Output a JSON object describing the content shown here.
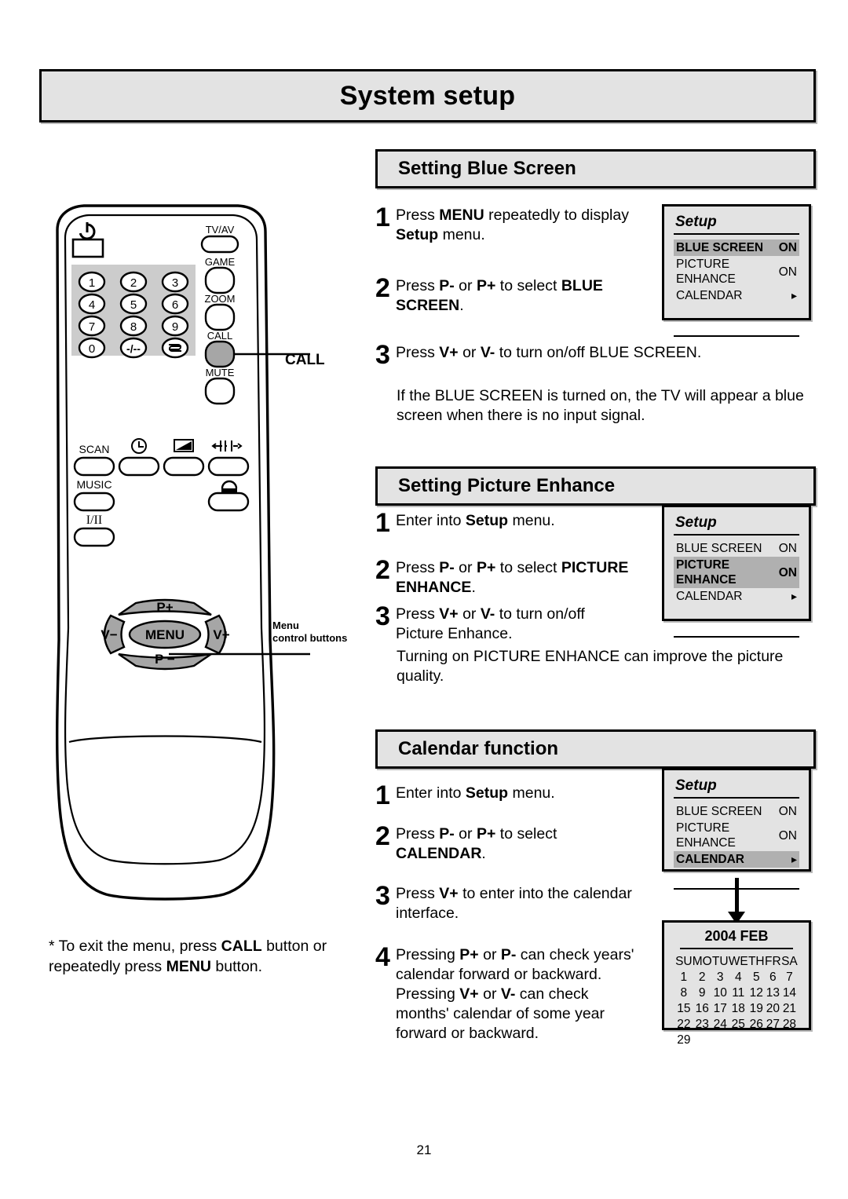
{
  "page": {
    "title": "System setup",
    "number": "21"
  },
  "remote": {
    "power_icon": "power-icon",
    "keypad": [
      "1",
      "2",
      "3",
      "4",
      "5",
      "6",
      "7",
      "8",
      "9",
      "0",
      "-/--",
      "swap-icon"
    ],
    "side_buttons": [
      "TV/AV",
      "GAME",
      "ZOOM",
      "CALL",
      "MUTE"
    ],
    "function_buttons": [
      "SCAN",
      "clock-icon",
      "contrast-icon",
      "p-position-icon",
      "MUSIC",
      "lock-icon",
      "I/II"
    ],
    "menu_cluster": {
      "up": "P+",
      "down": "P −",
      "left": "V−",
      "right": "V+",
      "center": "MENU"
    },
    "callouts": {
      "call": "CALL",
      "menu_controls_line1": "Menu",
      "menu_controls_line2": "control buttons"
    }
  },
  "sections": [
    {
      "heading": "Setting Blue Screen",
      "steps": [
        {
          "num": "1",
          "parts": [
            {
              "t": "Press ",
              "b": false
            },
            {
              "t": "MENU",
              "b": true
            },
            {
              "t": " repeatedly to display ",
              "b": false
            },
            {
              "t": "Setup",
              "b": true
            },
            {
              "t": " menu.",
              "b": false
            }
          ]
        },
        {
          "num": "2",
          "parts": [
            {
              "t": "Press ",
              "b": false
            },
            {
              "t": "P-",
              "b": true
            },
            {
              "t": " or ",
              "b": false
            },
            {
              "t": "P+",
              "b": true
            },
            {
              "t": " to select ",
              "b": false
            },
            {
              "t": "BLUE SCREEN",
              "b": true
            },
            {
              "t": ".",
              "b": false
            }
          ]
        },
        {
          "num": "3",
          "parts": [
            {
              "t": "Press ",
              "b": false
            },
            {
              "t": "V+",
              "b": true
            },
            {
              "t": " or ",
              "b": false
            },
            {
              "t": "V-",
              "b": true
            },
            {
              "t": " to turn on/off BLUE SCREEN.",
              "b": false
            }
          ]
        }
      ],
      "note": "If the BLUE SCREEN is turned on, the TV will appear a blue screen when there is no input signal.",
      "osd": {
        "title": "Setup",
        "rows": [
          {
            "label": "BLUE SCREEN",
            "value": "ON",
            "selected": true
          },
          {
            "label": "PICTURE ENHANCE",
            "value": "ON",
            "selected": false
          },
          {
            "label": "CALENDAR",
            "value": "▸",
            "selected": false
          }
        ]
      }
    },
    {
      "heading": "Setting Picture Enhance",
      "steps": [
        {
          "num": "1",
          "parts": [
            {
              "t": "Enter into ",
              "b": false
            },
            {
              "t": "Setup",
              "b": true
            },
            {
              "t": " menu.",
              "b": false
            }
          ]
        },
        {
          "num": "2",
          "parts": [
            {
              "t": "Press ",
              "b": false
            },
            {
              "t": "P-",
              "b": true
            },
            {
              "t": " or ",
              "b": false
            },
            {
              "t": "P+",
              "b": true
            },
            {
              "t": " to select ",
              "b": false
            },
            {
              "t": "PICTURE ENHANCE",
              "b": true
            },
            {
              "t": ".",
              "b": false
            }
          ]
        },
        {
          "num": "3",
          "parts": [
            {
              "t": "Press ",
              "b": false
            },
            {
              "t": "V+",
              "b": true
            },
            {
              "t": " or ",
              "b": false
            },
            {
              "t": "V-",
              "b": true
            },
            {
              "t": " to turn on/off Picture Enhance.",
              "b": false
            }
          ]
        }
      ],
      "note": "Turning on PICTURE ENHANCE can improve the picture quality.",
      "osd": {
        "title": "Setup",
        "rows": [
          {
            "label": "BLUE SCREEN",
            "value": "ON",
            "selected": false
          },
          {
            "label": "PICTURE ENHANCE",
            "value": "ON",
            "selected": true
          },
          {
            "label": "CALENDAR",
            "value": "▸",
            "selected": false
          }
        ]
      }
    },
    {
      "heading": "Calendar function",
      "steps": [
        {
          "num": "1",
          "parts": [
            {
              "t": "Enter into ",
              "b": false
            },
            {
              "t": "Setup",
              "b": true
            },
            {
              "t": " menu.",
              "b": false
            }
          ]
        },
        {
          "num": "2",
          "parts": [
            {
              "t": "Press ",
              "b": false
            },
            {
              "t": "P-",
              "b": true
            },
            {
              "t": " or ",
              "b": false
            },
            {
              "t": "P+",
              "b": true
            },
            {
              "t": " to select ",
              "b": false
            },
            {
              "t": "CALENDAR",
              "b": true
            },
            {
              "t": ".",
              "b": false
            }
          ]
        },
        {
          "num": "3",
          "parts": [
            {
              "t": "Press ",
              "b": false
            },
            {
              "t": "V+",
              "b": true
            },
            {
              "t": " to enter into the calendar interface.",
              "b": false
            }
          ]
        },
        {
          "num": "4",
          "parts": [
            {
              "t": "Pressing ",
              "b": false
            },
            {
              "t": "P+",
              "b": true
            },
            {
              "t": " or ",
              "b": false
            },
            {
              "t": "P-",
              "b": true
            },
            {
              "t": " can check years' calendar forward or backward.\nPressing ",
              "b": false
            },
            {
              "t": "V+",
              "b": true
            },
            {
              "t": " or ",
              "b": false
            },
            {
              "t": "V-",
              "b": true
            },
            {
              "t": " can check months' calendar of some year forward or backward.",
              "b": false
            }
          ]
        }
      ],
      "osd": {
        "title": "Setup",
        "rows": [
          {
            "label": "BLUE SCREEN",
            "value": "ON",
            "selected": false
          },
          {
            "label": "PICTURE ENHANCE",
            "value": "ON",
            "selected": false
          },
          {
            "label": "CALENDAR",
            "value": "▸",
            "selected": true
          }
        ]
      }
    }
  ],
  "calendar": {
    "title": "2004 FEB",
    "weekdays": [
      "SU",
      "MO",
      "TU",
      "WE",
      "TH",
      "FR",
      "SA"
    ],
    "weeks": [
      [
        "1",
        "2",
        "3",
        "4",
        "5",
        "6",
        "7"
      ],
      [
        "8",
        "9",
        "10",
        "11",
        "12",
        "13",
        "14"
      ],
      [
        "15",
        "16",
        "17",
        "18",
        "19",
        "20",
        "21"
      ],
      [
        "22",
        "23",
        "24",
        "25",
        "26",
        "27",
        "28"
      ],
      [
        "29",
        "",
        "",
        "",
        "",
        "",
        ""
      ]
    ]
  },
  "footnote": {
    "parts": [
      {
        "t": "* To exit the menu, press ",
        "b": false
      },
      {
        "t": "CALL",
        "b": true
      },
      {
        "t": " button or repeatedly press ",
        "b": false
      },
      {
        "t": "MENU",
        "b": true
      },
      {
        "t": " button.",
        "b": false
      }
    ]
  },
  "colors": {
    "panel_gray": "#e3e3e3",
    "highlight_gray": "#b0b0b0",
    "keypad_gray": "#cccccc",
    "button_gray": "#a6a6a6"
  }
}
